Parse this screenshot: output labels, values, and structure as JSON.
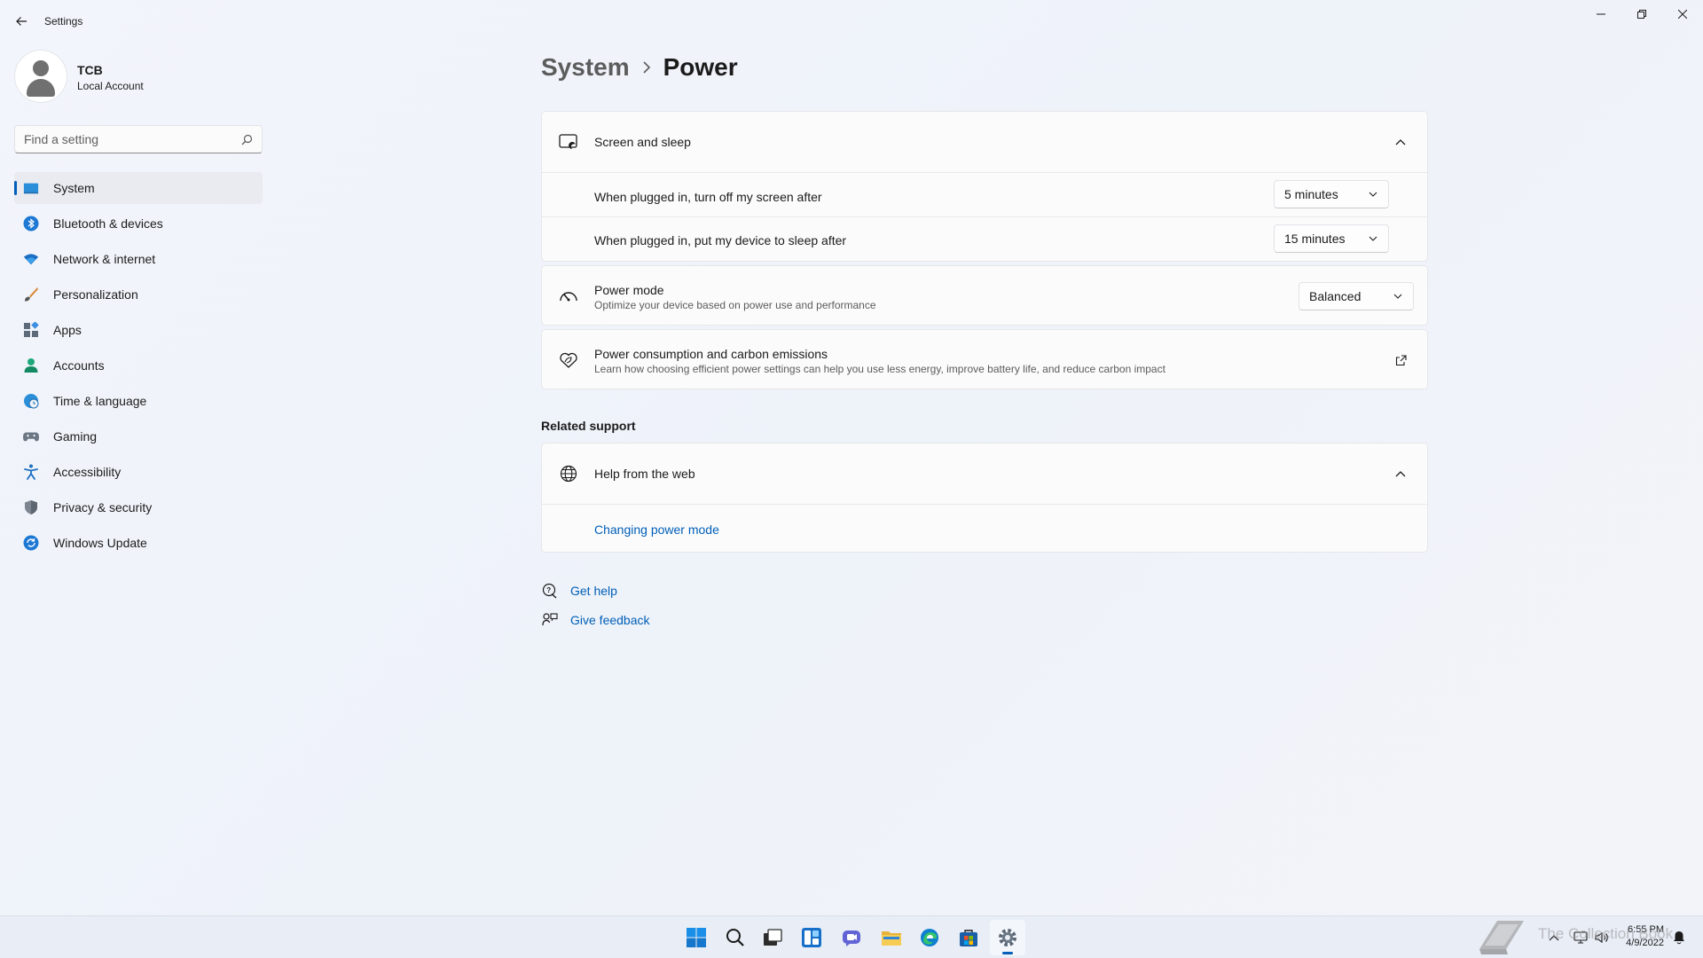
{
  "window": {
    "title": "Settings"
  },
  "profile": {
    "name": "TCB",
    "account_type": "Local Account"
  },
  "search": {
    "placeholder": "Find a setting"
  },
  "sidebar": {
    "items": [
      {
        "label": "System",
        "icon": "system-icon",
        "active": true
      },
      {
        "label": "Bluetooth & devices",
        "icon": "bluetooth-icon"
      },
      {
        "label": "Network & internet",
        "icon": "wifi-icon"
      },
      {
        "label": "Personalization",
        "icon": "brush-icon"
      },
      {
        "label": "Apps",
        "icon": "apps-icon"
      },
      {
        "label": "Accounts",
        "icon": "person-icon"
      },
      {
        "label": "Time & language",
        "icon": "globe-clock-icon"
      },
      {
        "label": "Gaming",
        "icon": "gamepad-icon"
      },
      {
        "label": "Accessibility",
        "icon": "accessibility-icon"
      },
      {
        "label": "Privacy & security",
        "icon": "shield-icon"
      },
      {
        "label": "Windows Update",
        "icon": "update-icon"
      }
    ]
  },
  "breadcrumb": {
    "parent": "System",
    "current": "Power"
  },
  "screen_sleep": {
    "title": "Screen and sleep",
    "rows": [
      {
        "label": "When plugged in, turn off my screen after",
        "value": "5 minutes"
      },
      {
        "label": "When plugged in, put my device to sleep after",
        "value": "15 minutes"
      }
    ]
  },
  "power_mode": {
    "title": "Power mode",
    "description": "Optimize your device based on power use and performance",
    "value": "Balanced"
  },
  "carbon": {
    "title": "Power consumption and carbon emissions",
    "description": "Learn how choosing efficient power settings can help you use less energy, improve battery life, and reduce carbon impact"
  },
  "related_support": {
    "heading": "Related support",
    "help_web_title": "Help from the web",
    "link": "Changing power mode"
  },
  "help_links": {
    "get_help": "Get help",
    "give_feedback": "Give feedback"
  },
  "taskbar": {
    "apps": [
      "start-icon",
      "search-icon",
      "task-view-icon",
      "widgets-icon",
      "chat-icon",
      "file-explorer-icon",
      "edge-icon",
      "store-icon",
      "settings-icon"
    ],
    "time": "6:55 PM",
    "date": "4/9/2022"
  },
  "watermark": {
    "text": "The Collection Book"
  },
  "colors": {
    "accent": "#005fb8",
    "background": "#f2f5fb",
    "card": "#fbfbfc"
  }
}
